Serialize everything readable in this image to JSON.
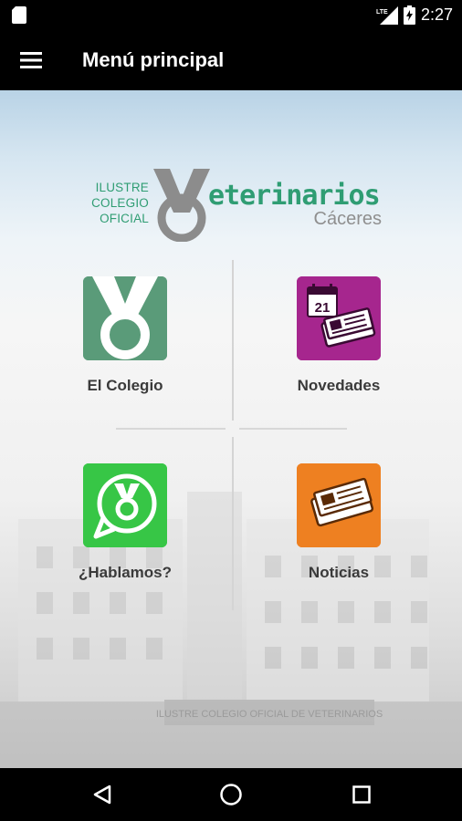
{
  "status_bar": {
    "time": "2:27",
    "network_label": "LTE",
    "icons": [
      "sd-card-icon",
      "signal-icon",
      "battery-icon"
    ]
  },
  "app_bar": {
    "title": "Menú principal",
    "menu_icon": "hamburger-menu-icon"
  },
  "logo": {
    "line1": "ILUSTRE",
    "line2": "COLEGIO",
    "line3": "OFICIAL",
    "word": "eterinarios",
    "city": "Cáceres",
    "brand_color": "#2f9d73"
  },
  "menu": {
    "tiles": [
      {
        "label": "El Colegio",
        "icon": "colegio-logo-icon",
        "color": "#5a9b79"
      },
      {
        "label": "Novedades",
        "icon": "calendar-newspaper-icon",
        "color": "#a6268e",
        "calendar_day": "21"
      },
      {
        "label": "¿Hablamos?",
        "icon": "chat-bubble-icon",
        "color": "#37c646"
      },
      {
        "label": "Noticias",
        "icon": "newspaper-icon",
        "color": "#ee8021"
      }
    ]
  },
  "background": {
    "building_sign": "ILUSTRE COLEGIO OFICIAL DE VETERINARIOS"
  },
  "nav_bar": {
    "buttons": [
      "back-icon",
      "home-icon",
      "recents-icon"
    ]
  }
}
